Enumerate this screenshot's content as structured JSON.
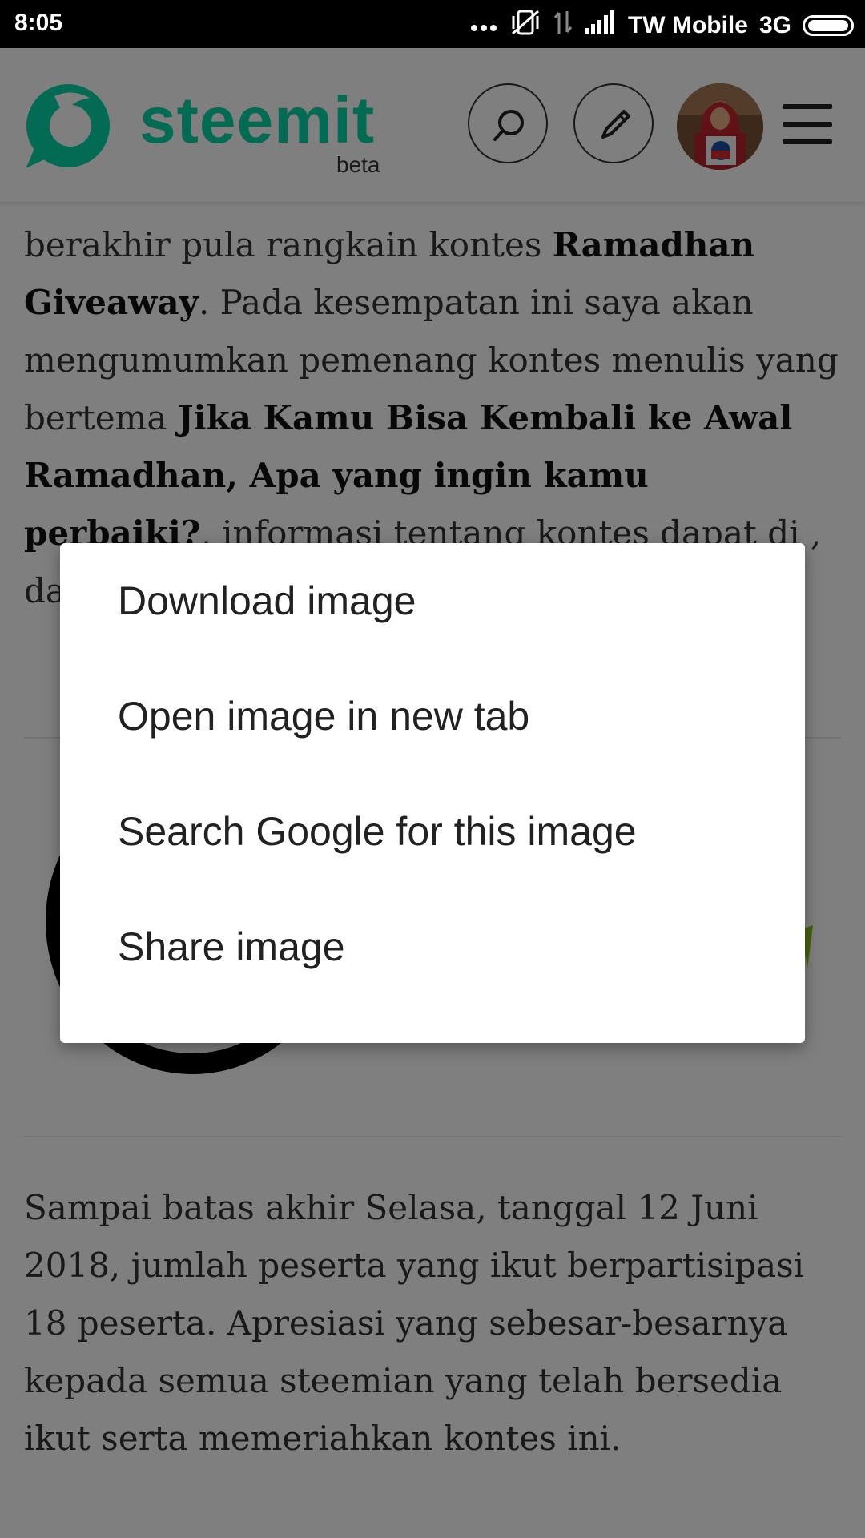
{
  "status_bar": {
    "time": "8:05",
    "carrier": "TW Mobile",
    "network": "3G"
  },
  "header": {
    "logo_text": "steemit",
    "logo_badge": "beta",
    "brand_color": "#06d6a9",
    "search_icon": "search-icon",
    "edit_icon": "pencil-icon",
    "menu_icon": "hamburger-icon"
  },
  "article": {
    "para1": [
      {
        "t": "berakhir pula rangkain kontes ",
        "b": false
      },
      {
        "t": "Ramadhan Giveaway",
        "b": true
      },
      {
        "t": ". Pada kesempatan ini saya akan mengumumkan pemenang kontes menulis yang bertema ",
        "b": false
      },
      {
        "t": "Jika Kamu Bisa Kembali ke Awal Ramadhan, Apa yang ingin kamu perbaiki?",
        "b": true
      },
      {
        "t": ", informasi tentang kontes dapat di",
        "b": false
      }
    ],
    "para1_tail": ",",
    "para1_start": "da",
    "para2": "Sampai batas akhir Selasa, tanggal 12 Juni 2018, jumlah peserta yang ikut berpartisipasi 18 peserta. Apresiasi yang sebesar-besarnya kepada semua steemian yang telah bersedia ikut serta memeriahkan kontes ini."
  },
  "context_menu": {
    "items": [
      "Download image",
      "Open image in new tab",
      "Search Google for this image",
      "Share image"
    ]
  }
}
